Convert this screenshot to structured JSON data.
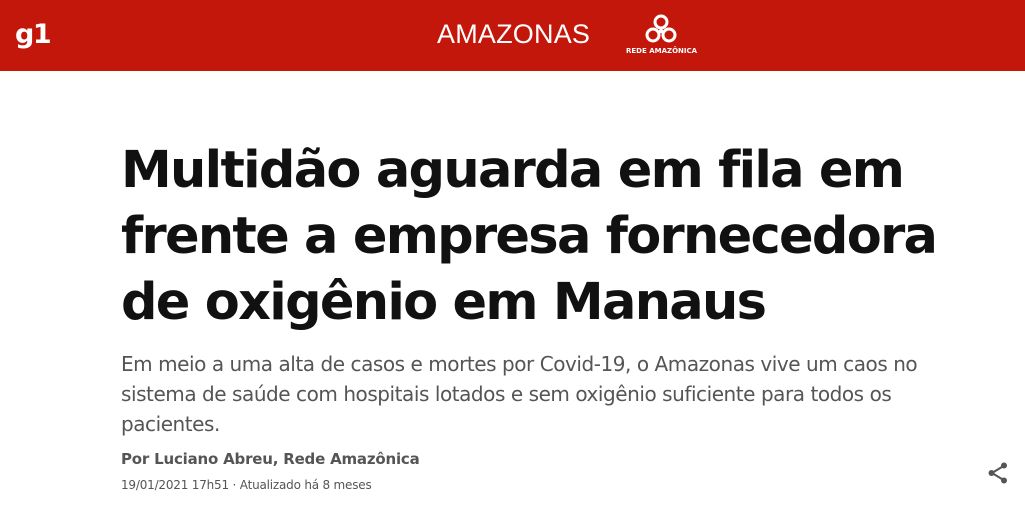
{
  "header": {
    "brand": "g1",
    "section": "AMAZONAS",
    "partner_logo_text": "REDE AMAZÔNICA",
    "background_color": "#c4170c"
  },
  "article": {
    "headline": "Multidão aguarda em fila em frente a empresa fornecedora de oxigênio em Manaus",
    "subtitle": "Em meio a uma alta de casos e mortes por Covid-19, o Amazonas vive um caos no sistema de saúde com hospitais lotados e sem oxigênio suficiente para todos os pacientes.",
    "byline": "Por Luciano Abreu, Rede Amazônica",
    "dateline": "19/01/2021 17h51 · Atualizado há 8 meses"
  },
  "icons": {
    "share": "share-icon"
  }
}
